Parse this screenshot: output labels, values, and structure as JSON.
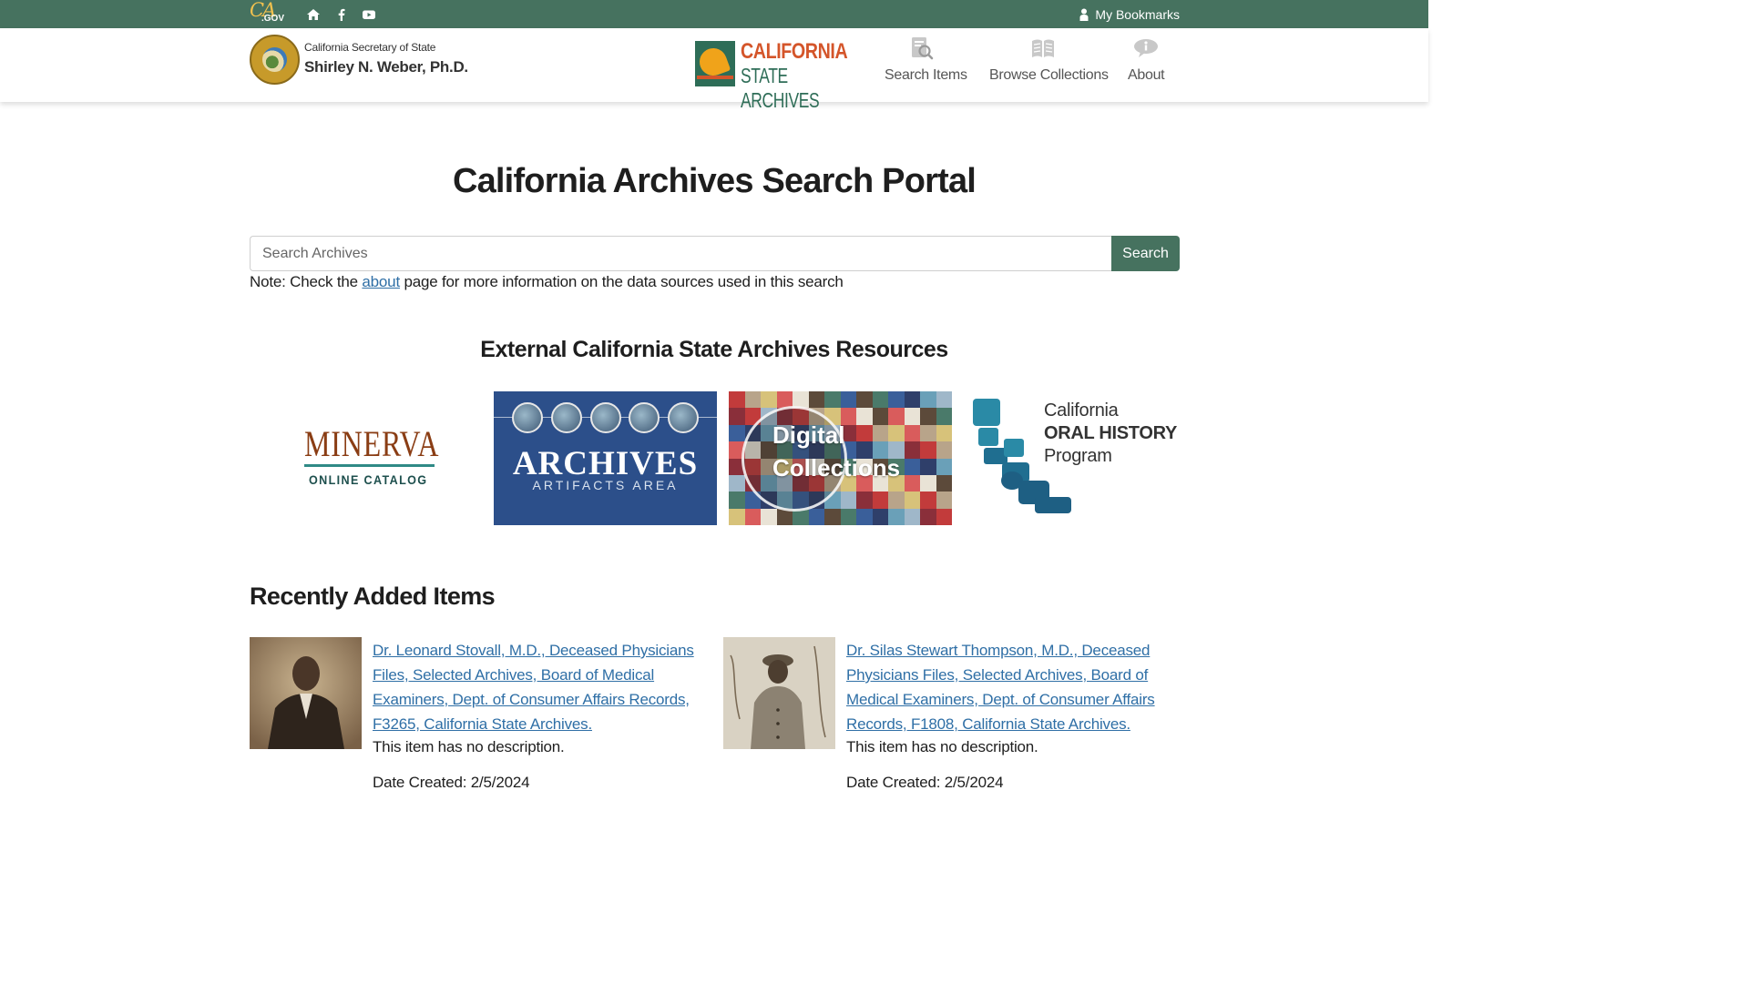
{
  "utility_bar": {
    "ca_gov_logo": "CA.GOV",
    "icons": [
      "home-icon",
      "facebook-icon",
      "youtube-icon"
    ],
    "bookmarks_label": "My Bookmarks",
    "background_color": "#46725f"
  },
  "header": {
    "sos_title": "California Secretary of State",
    "sos_name": "Shirley N. Weber, Ph.D.",
    "brand_line1": "CALIFORNIA",
    "brand_line2": "STATE ARCHIVES",
    "nav": [
      {
        "label": "Search Items",
        "icon": "search-document-icon"
      },
      {
        "label": "Browse Collections",
        "icon": "open-book-icon"
      },
      {
        "label": "About",
        "icon": "info-bubble-icon"
      }
    ]
  },
  "main": {
    "title": "California Archives Search Portal",
    "search": {
      "placeholder": "Search Archives",
      "value": "",
      "button_label": "Search"
    },
    "note": {
      "prefix": "Note: Check the ",
      "link": "about",
      "suffix": " page for more information on the data sources used in this search"
    },
    "external_title": "External California State Archives Resources",
    "resources": [
      {
        "line1": "MINERVA",
        "line2": "ONLINE CATALOG"
      },
      {
        "line1": "ARCHIVES",
        "line2": "ARTIFACTS AREA"
      },
      {
        "line1": "Digital",
        "line2": "Collections"
      },
      {
        "line1": "California",
        "line2": "ORAL HISTORY",
        "line3": "Program"
      }
    ],
    "recent_title": "Recently Added Items",
    "recent_items": [
      {
        "title": "Dr. Leonard Stovall, M.D., Deceased Physicians Files, Selected Archives, Board of Medical Examiners, Dept. of Consumer Affairs Records, F3265, California State Archives.",
        "description": "This item has no description.",
        "date": "Date Created: 2/5/2024"
      },
      {
        "title": "Dr. Silas Stewart Thompson, M.D., Deceased Physicians Files, Selected Archives, Board of Medical Examiners, Dept. of Consumer Affairs Records, F1808, California State Archives.",
        "description": "This item has no description.",
        "date": "Date Created: 2/5/2024"
      }
    ]
  },
  "colors": {
    "accent_green": "#46725f",
    "link_blue": "#2f6fa6",
    "brand_orange": "#d4552a"
  }
}
